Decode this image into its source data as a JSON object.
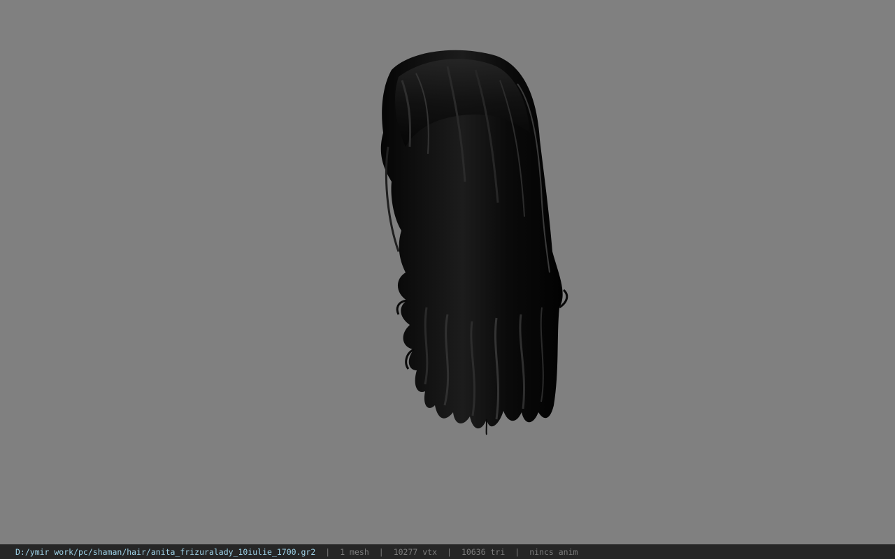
{
  "viewport": {
    "background_color": "#808080",
    "model": {
      "icon": "hair-mesh-icon",
      "color": "#0d0d0d"
    }
  },
  "status_bar": {
    "background_color": "#262626",
    "path_color": "#9fd3e8",
    "file_path": "D:/ymir work/pc/shaman/hair/anita_frizuralady_10iulie_1700.gr2",
    "separator": "|",
    "mesh_count": "1 mesh",
    "vertex_count": "10277 vtx",
    "triangle_count": "10636 tri",
    "anim_status": "nincs anim"
  }
}
